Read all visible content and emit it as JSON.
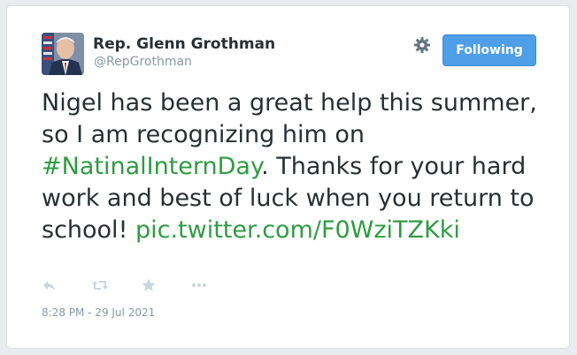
{
  "author": {
    "display_name": "Rep. Glenn Grothman",
    "handle": "@RepGrothman",
    "avatar_icon": "profile-photo"
  },
  "header": {
    "settings_icon": "gear-icon",
    "follow_button_label": "Following",
    "follow_button_color": "#4f9ee8"
  },
  "tweet": {
    "text_part1": "Nigel has been a great help this summer, so I am recognizing him on ",
    "hashtag": "#NatinalInternDay",
    "text_part2": ". Thanks for your hard work and best of luck when you return to school! ",
    "media_link": "pic.twitter.com/F0WziTZKki",
    "link_color": "#2e9c43"
  },
  "actions": [
    {
      "name": "reply-icon"
    },
    {
      "name": "retweet-icon"
    },
    {
      "name": "favorite-icon"
    },
    {
      "name": "more-icon"
    }
  ],
  "timestamp": "8:28 PM - 29 Jul 2021"
}
